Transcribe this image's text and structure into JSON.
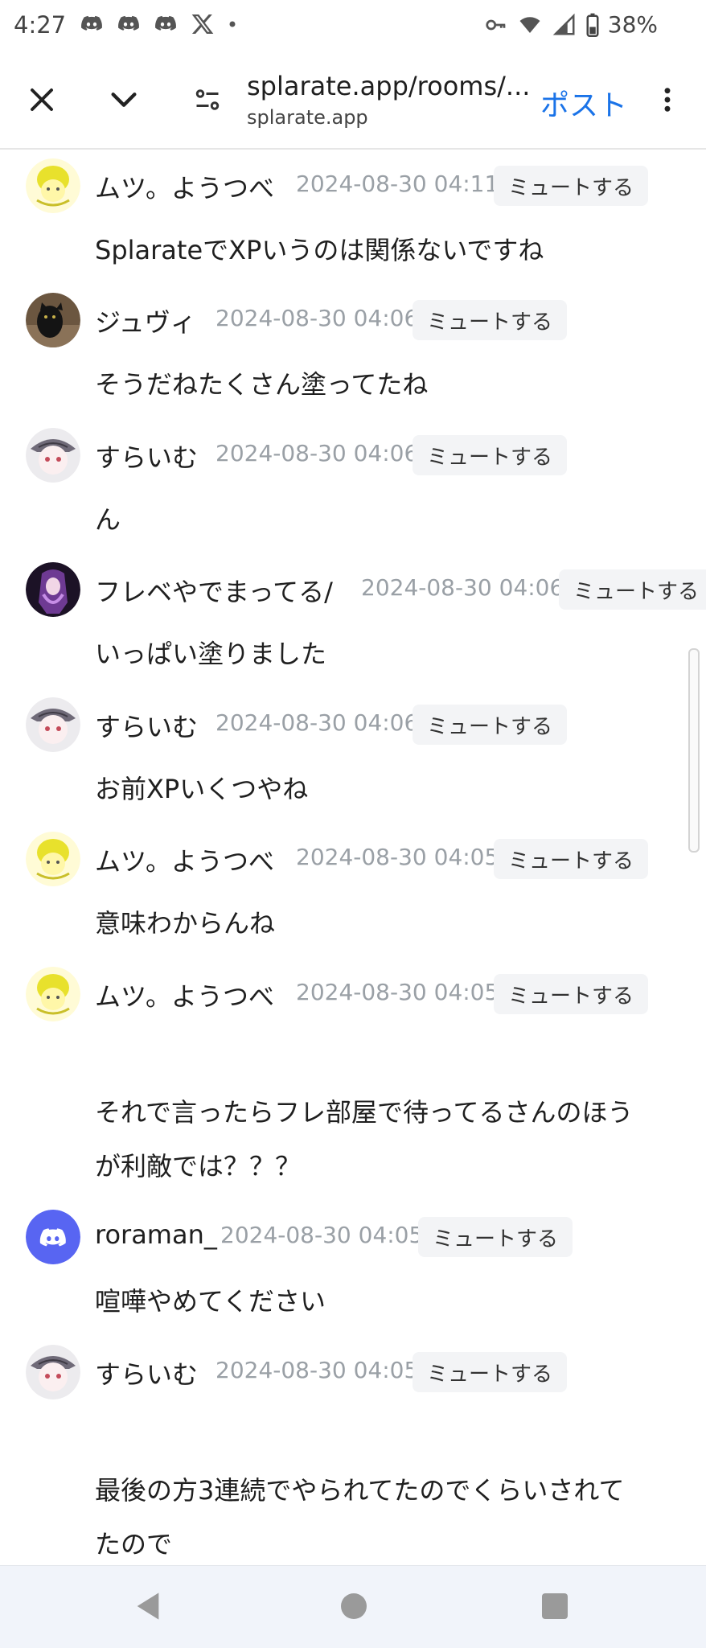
{
  "status_bar": {
    "time": "4:27",
    "battery": "38%"
  },
  "browser": {
    "url": "splarate.app/rooms/...",
    "domain": "splarate.app",
    "post_label": "ポスト",
    "accent_color": "#1a73e8"
  },
  "mute_label": "ミュートする",
  "messages": [
    {
      "avatar": "yellow-character",
      "name": "ムツ。ようつべ",
      "time": "2024-08-30 04:11",
      "lines": [
        "SplarateでXPいうのは関係ないですね"
      ]
    },
    {
      "avatar": "black-cat",
      "name": "ジュヴィ",
      "time": "2024-08-30 04:06",
      "lines": [
        "そうだねたくさん塗ってたね"
      ]
    },
    {
      "avatar": "gray-character",
      "name": "すらいむ",
      "time": "2024-08-30 04:06",
      "lines": [
        "ん"
      ]
    },
    {
      "avatar": "purple-character",
      "name": "フレベやでまってる/",
      "time": "2024-08-30 04:06",
      "lines": [
        "いっぱい塗りました"
      ]
    },
    {
      "avatar": "gray-character",
      "name": "すらいむ",
      "time": "2024-08-30 04:06",
      "lines": [
        "お前XPいくつやね"
      ]
    },
    {
      "avatar": "yellow-character",
      "name": "ムツ。ようつべ",
      "time": "2024-08-30 04:05",
      "lines": [
        "意味わからんね"
      ]
    },
    {
      "avatar": "yellow-character",
      "name": "ムツ。ようつべ",
      "time": "2024-08-30 04:05",
      "lines": [
        "",
        "それで言ったらフレ部屋で待ってるさんのほう",
        "が利敵では？？？"
      ]
    },
    {
      "avatar": "discord-logo",
      "name": "roraman_",
      "time": "2024-08-30 04:05",
      "lines": [
        "喧嘩やめてください"
      ]
    },
    {
      "avatar": "gray-character",
      "name": "すらいむ",
      "time": "2024-08-30 04:05",
      "lines": [
        "",
        "最後の方3連続でやられてたのでくらいされて",
        "たので"
      ]
    }
  ]
}
